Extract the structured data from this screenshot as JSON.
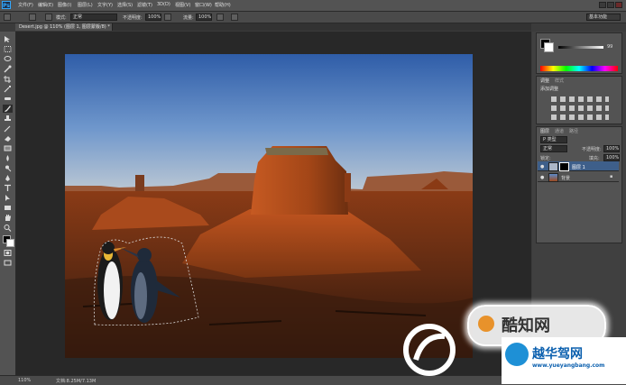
{
  "app": {
    "logo": "Ps"
  },
  "menu": [
    "文件(F)",
    "编辑(E)",
    "图像(I)",
    "图层(L)",
    "文字(Y)",
    "选择(S)",
    "滤镜(T)",
    "3D(D)",
    "视图(V)",
    "窗口(W)",
    "帮助(H)"
  ],
  "options": {
    "mode_label": "模式:",
    "mode_value": "正常",
    "opacity_label": "不透明度:",
    "opacity_value": "100%",
    "flow_label": "流量:",
    "flow_value": "100%",
    "workspace": "基本功能"
  },
  "document": {
    "tab_title": "Desert.jpg @ 110% (图层 1, 图层蒙版/8) *"
  },
  "color_panel": {
    "value": "99"
  },
  "adjustments": {
    "tab1": "调整",
    "tab2": "样式",
    "title": "添加调整"
  },
  "layers": {
    "tabs": [
      "图层",
      "通道",
      "路径"
    ],
    "kind_label": "P 类型",
    "blend": "正常",
    "opacity_label": "不透明度:",
    "opacity": "100%",
    "lock_label": "锁定:",
    "fill_label": "填充:",
    "fill": "100%",
    "items": [
      {
        "name": "图层 1",
        "selected": true
      },
      {
        "name": "背景",
        "selected": false
      }
    ]
  },
  "status": {
    "zoom": "110%",
    "doc_info": "文档:8.25M/7.13M"
  },
  "watermarks": {
    "brand1": "酷知网",
    "brand2": "越华驾网",
    "url": "www.yueyangbang.com"
  },
  "colors": {
    "accent": "#31a8ff",
    "selection": "#3e5f8a",
    "bg": "#3b3b3b"
  }
}
